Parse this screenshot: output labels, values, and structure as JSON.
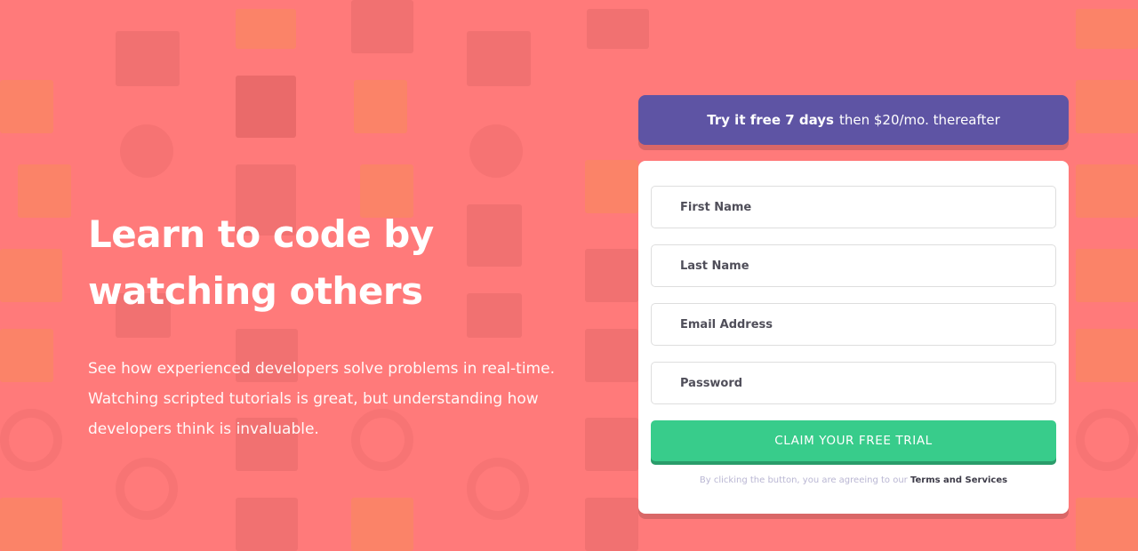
{
  "hero": {
    "title": "Learn to code by watching others",
    "description": "See how experienced developers solve problems in real-time. Watching scripted tutorials is great, but understanding how developers think is invaluable."
  },
  "offer": {
    "highlight": "Try it free 7 days",
    "rest": "then $20/mo. thereafter"
  },
  "form": {
    "first_name_placeholder": "First Name",
    "last_name_placeholder": "Last Name",
    "email_placeholder": "Email Address",
    "password_placeholder": "Password",
    "submit_label": "CLAIM YOUR FREE TRIAL",
    "terms_prefix": "By clicking the button, you are agreeing to our",
    "terms_link": "Terms and Services"
  },
  "colors": {
    "background": "#ff7a7a",
    "banner": "#5e54a4",
    "button": "#38cc8b",
    "button_shadow": "#2a9c6a",
    "text_dark": "#3d3b48",
    "terms_text": "#b9b6d3"
  }
}
